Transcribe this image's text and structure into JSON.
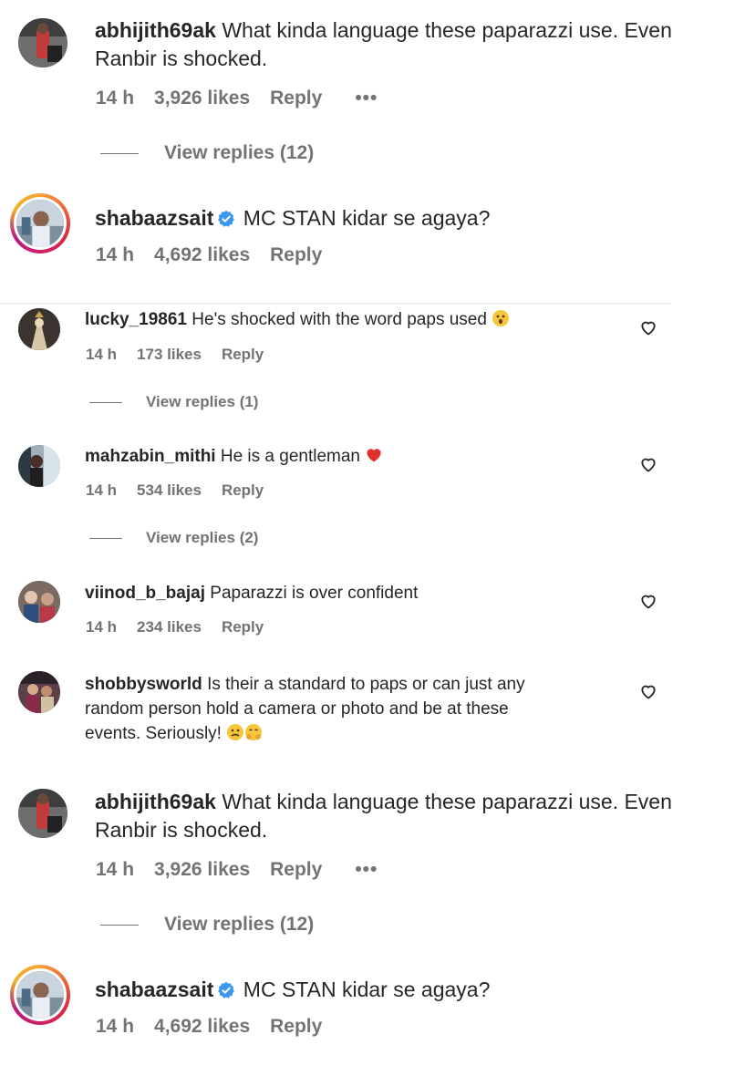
{
  "comments": [
    {
      "username": "abhijith69ak",
      "text": "What kinda language these paparazzi use. Even Ranbir is shocked.",
      "time": "14 h",
      "likes": "3,926 likes",
      "reply": "Reply",
      "more": "•••",
      "view_replies": "View replies (12)"
    },
    {
      "username": "shabaazsait",
      "verified": true,
      "text": "MC STAN kidar se agaya?",
      "time": "14 h",
      "likes": "4,692 likes",
      "reply": "Reply"
    },
    {
      "username": "lucky_19861",
      "text": "He's shocked with the word paps used",
      "emoji": "astonished-face",
      "time": "14 h",
      "likes": "173 likes",
      "reply": "Reply",
      "view_replies": "View replies (1)"
    },
    {
      "username": "mahzabin_mithi",
      "text": "He is a gentleman",
      "emoji": "red-heart",
      "time": "14 h",
      "likes": "534 likes",
      "reply": "Reply",
      "view_replies": "View replies (2)"
    },
    {
      "username": "viinod_b_bajaj",
      "text": "Paparazzi is over confident",
      "time": "14 h",
      "likes": "234 likes",
      "reply": "Reply"
    },
    {
      "username": "shobbysworld",
      "text_line1": "Is their a standard to paps or can just any",
      "text_line2": "random person hold a camera or photo and be at these",
      "text_line3": "events. Seriously!",
      "emoji": "hushed-and-hugging-faces"
    },
    {
      "username": "abhijith69ak",
      "text": "What kinda language these paparazzi use. Even Ranbir is shocked.",
      "time": "14 h",
      "likes": "3,926 likes",
      "reply": "Reply",
      "more": "•••",
      "view_replies": "View replies (12)"
    },
    {
      "username": "shabaazsait",
      "verified": true,
      "text": "MC STAN kidar se agaya?",
      "time": "14 h",
      "likes": "4,692 likes",
      "reply": "Reply"
    }
  ],
  "colors": {
    "text": "#262626",
    "secondary": "#737373",
    "verified": "#3897f0",
    "heart": "#e0302c"
  }
}
